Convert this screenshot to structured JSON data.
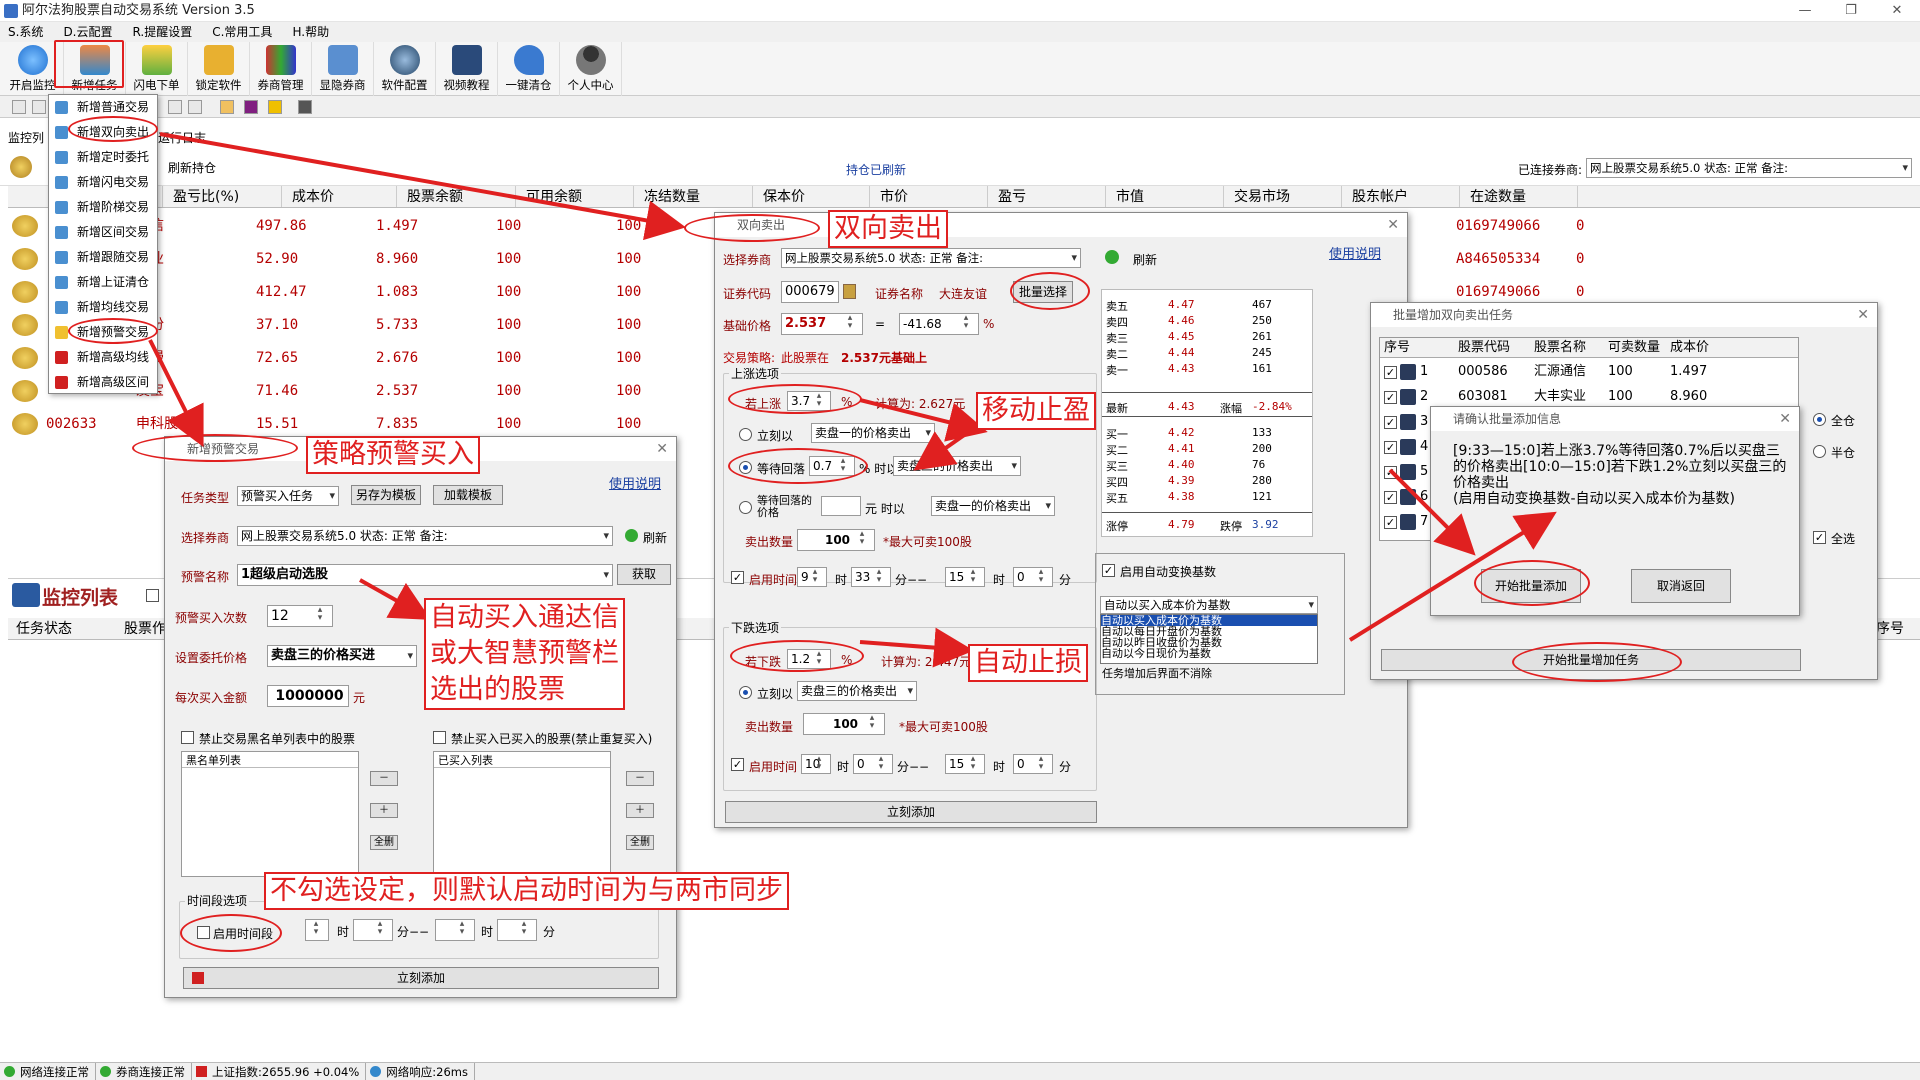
{
  "window": {
    "title": "阿尔法狗股票自动交易系统 Version 3.5",
    "controls": [
      "—",
      "❐",
      "✕"
    ]
  },
  "menu": [
    "S.系统",
    "D.云配置",
    "R.提醒设置",
    "C.常用工具",
    "H.帮助"
  ],
  "toolbar": [
    "开启监控",
    "新增任务",
    "闪电下单",
    "锁定软件",
    "券商管理",
    "显隐券商",
    "软件配置",
    "视频教程",
    "一键清仓",
    "个人中心"
  ],
  "dropdown": [
    "新增普通交易",
    "新增双向卖出",
    "新增定时委托",
    "新增闪电交易",
    "新增阶梯交易",
    "新增区间交易",
    "新增跟随交易",
    "新增上证清仓",
    "新增均线交易",
    "新增预警交易",
    "新增高级均线",
    "新增高级区间"
  ],
  "tabs": {
    "monitor": "监控列",
    "log": "运行日志"
  },
  "holdings": {
    "refresh": "刷新持仓",
    "refreshed": "持仓已刷新",
    "connected_label": "已连接券商:",
    "connected_value": "网上股票交易系统5.0 状态: 正常 备注:"
  },
  "grid": {
    "headers": [
      "证券名称",
      "盈亏比(%)",
      "成本价",
      "股票余额",
      "可用余额",
      "冻结数量",
      "保本价",
      "市价",
      "盈亏",
      "市值",
      "交易市场",
      "股东帐户",
      "在途数量"
    ],
    "rows": [
      {
        "name": "通信",
        "pct": "497.86",
        "cost": "1.497",
        "bal": "100",
        "avail": "100",
        "acct": "0169749066",
        "transit": "0"
      },
      {
        "name": "实业",
        "pct": "52.90",
        "cost": "8.960",
        "bal": "100",
        "avail": "100",
        "acct": "A846505334",
        "transit": "0"
      },
      {
        "name": "迅",
        "pct": "412.47",
        "cost": "1.083",
        "bal": "100",
        "avail": "100",
        "acct": "0169749066",
        "transit": "0"
      },
      {
        "name": "股份",
        "pct": "37.10",
        "cost": "5.733",
        "bal": "100",
        "avail": "100"
      },
      {
        "name": "动漫",
        "pct": "72.65",
        "cost": "2.676",
        "bal": "100",
        "avail": "100"
      },
      {
        "name": "友宝",
        "pct": "71.46",
        "cost": "2.537",
        "bal": "100",
        "avail": "100"
      },
      {
        "code": "002633",
        "name": "申科股份",
        "pct": "15.51",
        "cost": "7.835",
        "bal": "100",
        "avail": "100"
      }
    ]
  },
  "monitor": {
    "title": "监控列表",
    "headers": [
      "任务状态",
      "股票作"
    ],
    "right_header": "序号"
  },
  "warn_dialog": {
    "title": "新增预警交易",
    "help": "使用说明",
    "type_label": "任务类型",
    "type_value": "预警买入任务",
    "save_tpl": "另存为模板",
    "load_tpl": "加载模板",
    "broker_label": "选择券商",
    "broker_value": "网上股票交易系统5.0 状态: 正常 备注:",
    "refresh": "刷新",
    "warn_label": "预警名称",
    "warn_value": "1超级启动选股",
    "fetch": "获取",
    "times_label": "预警买入次数",
    "times_value": "12",
    "price_label": "设置委托价格",
    "price_value": "卖盘三的价格买进",
    "amount_label": "每次买入金额",
    "amount_value": "1000000",
    "amount_unit": "元",
    "black_chk": "禁止交易黑名单列表中的股票",
    "bought_chk": "禁止买入已买入的股票(禁止重复买入)",
    "black_list": "黑名单列表",
    "bought_list": "已买入列表",
    "minus": "－",
    "plus": "＋",
    "clear": "全删",
    "time_group": "时间段选项",
    "time_chk": "启用时间段",
    "h": "时",
    "m": "分",
    "dash": "分−−",
    "sep": "分",
    "add": "立刻添加"
  },
  "bi_dialog": {
    "title": "双向卖出",
    "help": "使用说明",
    "broker_label": "选择券商",
    "broker_value": "网上股票交易系统5.0 状态: 正常 备注:",
    "refresh": "刷新",
    "code_label": "证券代码",
    "code_value": "000679",
    "name_label": "证券名称",
    "name_value": "大连友谊",
    "batch": "批量选择",
    "base_label": "基础价格",
    "base_value": "2.537",
    "eq": "=",
    "pct_value": "-41.68",
    "pct_unit": "%",
    "strategy_label": "交易策略:",
    "strategy_text": "此股票在",
    "strategy_val": "2.537元基础上",
    "up_group": "上涨选项",
    "up_label": "若上涨",
    "up_value": "3.7",
    "up_unit": "%",
    "up_calc": "计算为: 2.627元",
    "r_now": "立刻以",
    "r_now_sel": "卖盘一的价格卖出",
    "r_wait": "等待回落",
    "r_wait_val": "0.7",
    "r_wait_unit": "% 时以",
    "r_wait_sel": "卖盘三的价格卖出",
    "r_wait2": "等待回落的价格",
    "r_wait2_unit": "元 时以",
    "r_wait2_sel": "卖盘一的价格卖出",
    "qty_label": "卖出数量",
    "qty_value": "100",
    "qty_max": "*最大可卖100股",
    "time_label": "启用时间",
    "t1h": "9",
    "t1m": "33",
    "t2h": "15",
    "t2m": "0",
    "h": "时",
    "m": "分",
    "dash": "分−−",
    "down_group": "下跌选项",
    "down_label": "若下跌",
    "down_value": "1.2",
    "down_unit": "%",
    "down_calc": "计算为: 2.447元",
    "d_now": "立刻以",
    "d_now_sel": "卖盘三的价格卖出",
    "d_qty": "100",
    "d_t1h": "10",
    "d_t1m": "0",
    "d_t2h": "15",
    "d_t2m": "0",
    "add": "立刻添加",
    "auto_chk": "启用自动变换基数",
    "auto_sel": "自动以买入成本价为基数",
    "auto_opts": [
      "自动以买入成本价为基数",
      "自动以每日开盘价为基数",
      "自动以昨日收盘价为基数",
      "自动以今日现价为基数"
    ],
    "auto_last": "任务增加后界面不消除"
  },
  "orderbook": {
    "sells": [
      [
        "卖五",
        "4.47",
        "467"
      ],
      [
        "卖四",
        "4.46",
        "250"
      ],
      [
        "卖三",
        "4.45",
        "261"
      ],
      [
        "卖二",
        "4.44",
        "245"
      ],
      [
        "卖一",
        "4.43",
        "161"
      ]
    ],
    "latest": [
      "最新",
      "4.43",
      "涨幅",
      "-2.84%"
    ],
    "buys": [
      [
        "买一",
        "4.42",
        "133"
      ],
      [
        "买二",
        "4.41",
        "200"
      ],
      [
        "买三",
        "4.40",
        "76"
      ],
      [
        "买四",
        "4.39",
        "280"
      ],
      [
        "买五",
        "4.38",
        "121"
      ]
    ],
    "limit": [
      "涨停",
      "4.79",
      "跌停",
      "3.92"
    ]
  },
  "batch_dialog": {
    "title": "批量增加双向卖出任务",
    "headers": [
      "序号",
      "股票代码",
      "股票名称",
      "可卖数量",
      "成本价"
    ],
    "rows": [
      [
        "1",
        "000586",
        "汇源通信",
        "100",
        "1.497"
      ],
      [
        "2",
        "603081",
        "大丰实业",
        "100",
        "8.960"
      ],
      [
        "3"
      ],
      [
        "4"
      ],
      [
        "5"
      ],
      [
        "6"
      ],
      [
        "7"
      ]
    ],
    "r_all": "全仓",
    "r_half": "半仓",
    "sel_all": "全选",
    "start": "开始批量增加任务"
  },
  "confirm": {
    "title": "请确认批量添加信息",
    "text": "[9:33—15:0]若上涨3.7%等待回落0.7%后以买盘三的价格卖出[10:0—15:0]若下跌1.2%立刻以买盘三的价格卖出\n(启用自动变换基数-自动以买入成本价为基数)",
    "ok": "开始批量添加",
    "cancel": "取消返回"
  },
  "annotations": {
    "bi": "双向卖出",
    "warn": "策略预警买入",
    "profit": "移动止盈",
    "loss": "自动止损",
    "auto_buy": "自动买入通达信\n或大智慧预警栏\n选出的股票",
    "time_note": "不勾选设定，则默认启动时间为与两市同步"
  },
  "status": [
    "网络连接正常",
    "券商连接正常",
    "上证指数:2655.96 +0.04%",
    "网络响应:26ms"
  ],
  "colors": {
    "accent": "#e02020",
    "label": "#8b0000",
    "link": "#1a3fa0"
  }
}
